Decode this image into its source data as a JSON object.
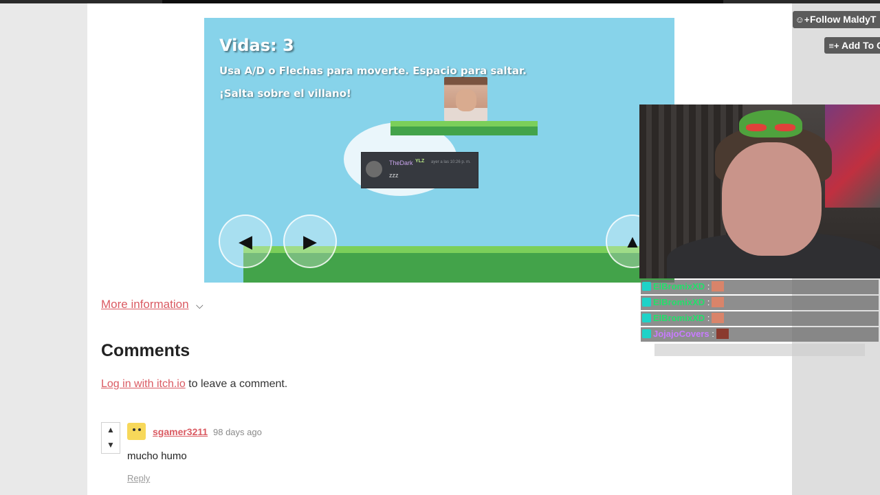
{
  "game": {
    "lives": "Vidas: 3",
    "instructions": "Usa A/D o Flechas para moverte. Espacio para saltar.",
    "goal": "¡Salta sobre el villano!",
    "chat_card": {
      "username": "TheDark",
      "badge": "YLZ",
      "timestamp": "ayer a las 10:26 p. m.",
      "message": "zzz"
    },
    "controls": {
      "left": "◀",
      "right": "▶",
      "jump": "▲"
    }
  },
  "page": {
    "more_info": "More information",
    "more_info_icon": "chevron-down-icon",
    "comments_title": "Comments",
    "login_link": "Log in with itch.io",
    "login_suffix": " to leave a comment."
  },
  "comment": {
    "username": "sgamer3211",
    "time": "98 days ago",
    "body": "mucho humo",
    "reply": "Reply",
    "upvote": "▲",
    "downvote": "▼"
  },
  "sidebar": {
    "follow_label": "Follow MaldyT",
    "follow_icon": "user-plus-icon",
    "add_label": "Add To C",
    "add_icon": "playlist-add-icon"
  },
  "stream_chat": [
    {
      "user": "ElBromixXD",
      "sep": " :",
      "color": "#22e06a"
    },
    {
      "user": "ElBromixXD",
      "sep": " :",
      "color": "#22e06a"
    },
    {
      "user": "ElBromixXD",
      "sep": " :",
      "color": "#22e06a"
    },
    {
      "user": "JojajoCovers",
      "sep": " :",
      "color": "#c87bff"
    }
  ],
  "colors": {
    "link": "#da5a62",
    "sky": "#87d3ea",
    "grass": "#43a34a",
    "grass_top": "#7bcf5a"
  }
}
